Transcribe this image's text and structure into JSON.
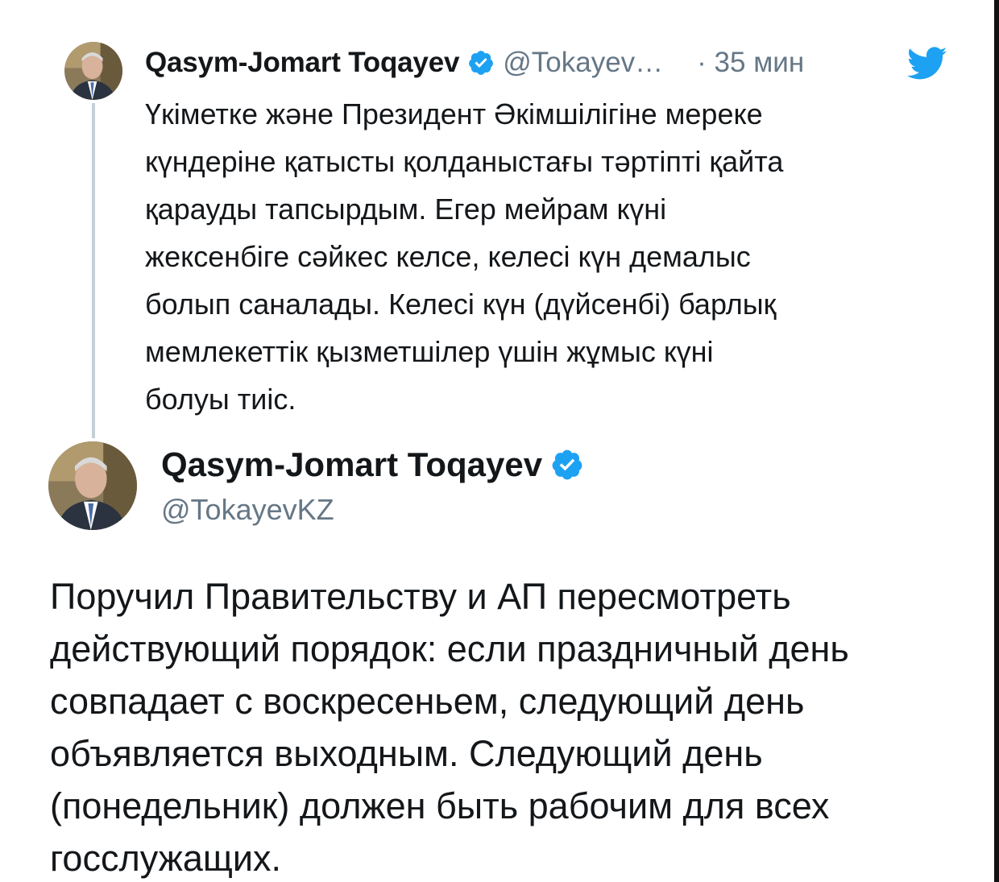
{
  "quoted_tweet": {
    "author_name": "Qasym-Jomart Toqayev",
    "handle": "@Tokayev…",
    "time": "· 35 мин",
    "avatar_icon": "profile-photo",
    "verified_icon": "verified-badge-icon",
    "brand_icon": "twitter-bird-icon",
    "text": "Үкіметке және Президент Әкімшілігіне мереке\nкүндеріне қатысты қолданыстағы тәртіпті қайта\nқарауды тапсырдым. Егер мейрам күні\nжексенбіге сәйкес келсе, келесі күн демалыс\nболып саналады. Келесі күн (дүйсенбі) барлық\nмемлекеттік қызметшілер үшін жұмыс күні\nболуы тиіс."
  },
  "main_tweet": {
    "author_name": "Qasym-Jomart Toqayev",
    "handle": "@TokayevKZ",
    "avatar_icon": "profile-photo",
    "verified_icon": "verified-badge-icon",
    "text": "Поручил Правительству и АП пересмотреть\nдействующий порядок: если праздничный день\nсовпадает с воскресеньем, следующий день\nобъявляется выходным. Следующий день\n(понедельник) должен быть рабочим для всех\nгосслужащих."
  },
  "colors": {
    "verified": "#1da1f2",
    "twitter_blue": "#1da1f2",
    "secondary_text": "#657786",
    "thread_line": "#c4cfd6"
  }
}
